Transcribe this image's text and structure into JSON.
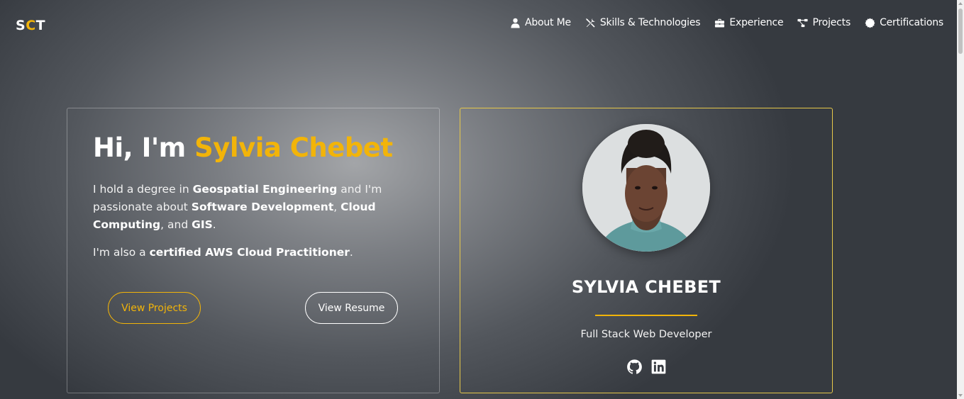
{
  "logo": {
    "prefix": "S",
    "highlight": "C",
    "suffix": "T"
  },
  "nav": {
    "items": [
      {
        "label": "About Me",
        "icon": "user-icon"
      },
      {
        "label": "Skills & Technologies",
        "icon": "tools-icon"
      },
      {
        "label": "Experience",
        "icon": "briefcase-icon"
      },
      {
        "label": "Projects",
        "icon": "project-diagram-icon"
      },
      {
        "label": "Certifications",
        "icon": "certificate-icon"
      }
    ]
  },
  "hero": {
    "greeting": "Hi, I'm ",
    "name": "Sylvia Chebet",
    "p1_a": "I hold a degree in ",
    "p1_b": "Geospatial Engineering",
    "p1_c": " and I'm passionate about ",
    "p1_d": "Software Development",
    "p1_e": ", ",
    "p1_f": "Cloud Computing",
    "p1_g": ", and ",
    "p1_h": "GIS",
    "p1_i": ".",
    "p2_a": "I'm also a ",
    "p2_b": "certified AWS Cloud Practitioner",
    "p2_c": ".",
    "btn_projects": "View Projects",
    "btn_resume": "View Resume"
  },
  "profile": {
    "name": "SYLVIA CHEBET",
    "role": "Full Stack Web Developer",
    "socials": [
      "github-icon",
      "linkedin-icon"
    ]
  },
  "colors": {
    "accent": "#f2b409",
    "card_border": "#e6c84a",
    "background": "#363a40"
  }
}
